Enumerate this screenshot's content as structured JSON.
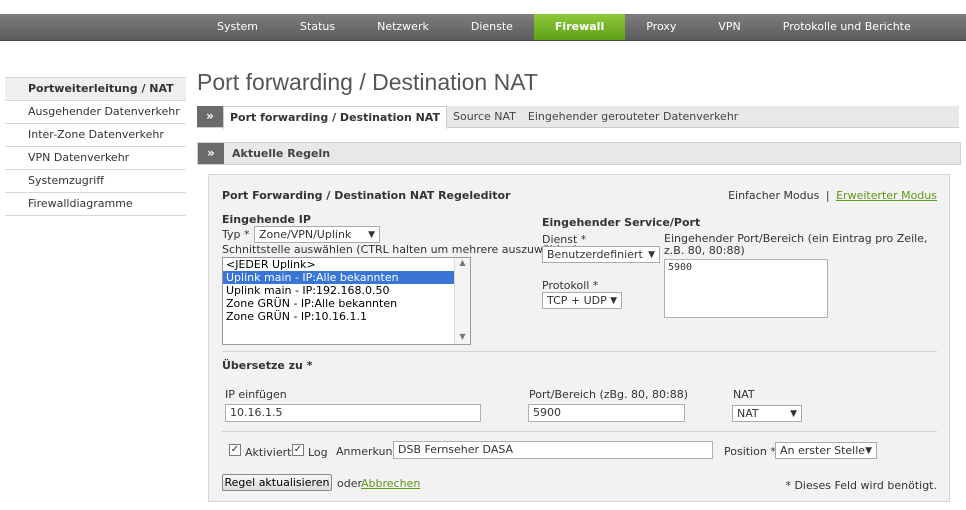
{
  "topnav": [
    "System",
    "Status",
    "Netzwerk",
    "Dienste",
    "Firewall",
    "Proxy",
    "VPN",
    "Protokolle und Berichte"
  ],
  "topnav_active": "Firewall",
  "sidebar": [
    "Portweiterleitung / NAT",
    "Ausgehender Datenverkehr",
    "Inter-Zone Datenverkehr",
    "VPN Datenverkehr",
    "Systemzugriff",
    "Firewalldiagramme"
  ],
  "page_title": "Port forwarding / Destination NAT",
  "tabs": {
    "chev": "»",
    "items": [
      "Port forwarding / Destination NAT",
      "Source NAT",
      "Eingehender gerouteter Datenverkehr"
    ]
  },
  "section": {
    "chev": "»",
    "title": "Aktuelle Regeln"
  },
  "editor": {
    "title": "Port Forwarding / Destination NAT Regeleditor",
    "mode_simple": "Einfacher Modus",
    "mode_sep": "|",
    "mode_advanced": "Erweiterter Modus",
    "incoming_ip_label": "Eingehende IP",
    "type_label": "Typ *",
    "type_value": "Zone/VPN/Uplink",
    "iface_hint": "Schnittstelle auswählen (CTRL halten um mehrere auszuwählen)",
    "iface_options": [
      "<JEDER Uplink>",
      "Uplink main - IP:Alle bekannten",
      "Uplink main - IP:192.168.0.50",
      "Zone GRÜN - IP:Alle bekannten",
      "Zone GRÜN - IP:10.16.1.1"
    ],
    "service_port_label": "Eingehender Service/Port",
    "service_label": "Dienst *",
    "service_value": "Benutzerdefiniert",
    "port_range_label": "Eingehender Port/Bereich (ein Eintrag pro Zeile, z.B. 80, 80:88)",
    "port_value": "5900",
    "protocol_label": "Protokoll *",
    "protocol_value": "TCP + UDP",
    "translate_label": "Übersetze zu *",
    "ip_insert_label": "IP einfügen",
    "ip_value": "10.16.1.5",
    "port_range2_label": "Port/Bereich (zBg. 80, 80:88)",
    "port2_value": "5900",
    "nat_label": "NAT",
    "nat_value": "NAT",
    "active_label": "Aktiviert",
    "log_label": "Log",
    "remark_label": "Anmerkung",
    "remark_value": "DSB Fernseher DASA",
    "position_label": "Position *",
    "position_value": "An erster Stelle",
    "update_button": "Regel aktualisieren",
    "or_text": "oder",
    "cancel_link": "Abbrechen",
    "required_note": "* Dieses Feld wird benötigt."
  }
}
